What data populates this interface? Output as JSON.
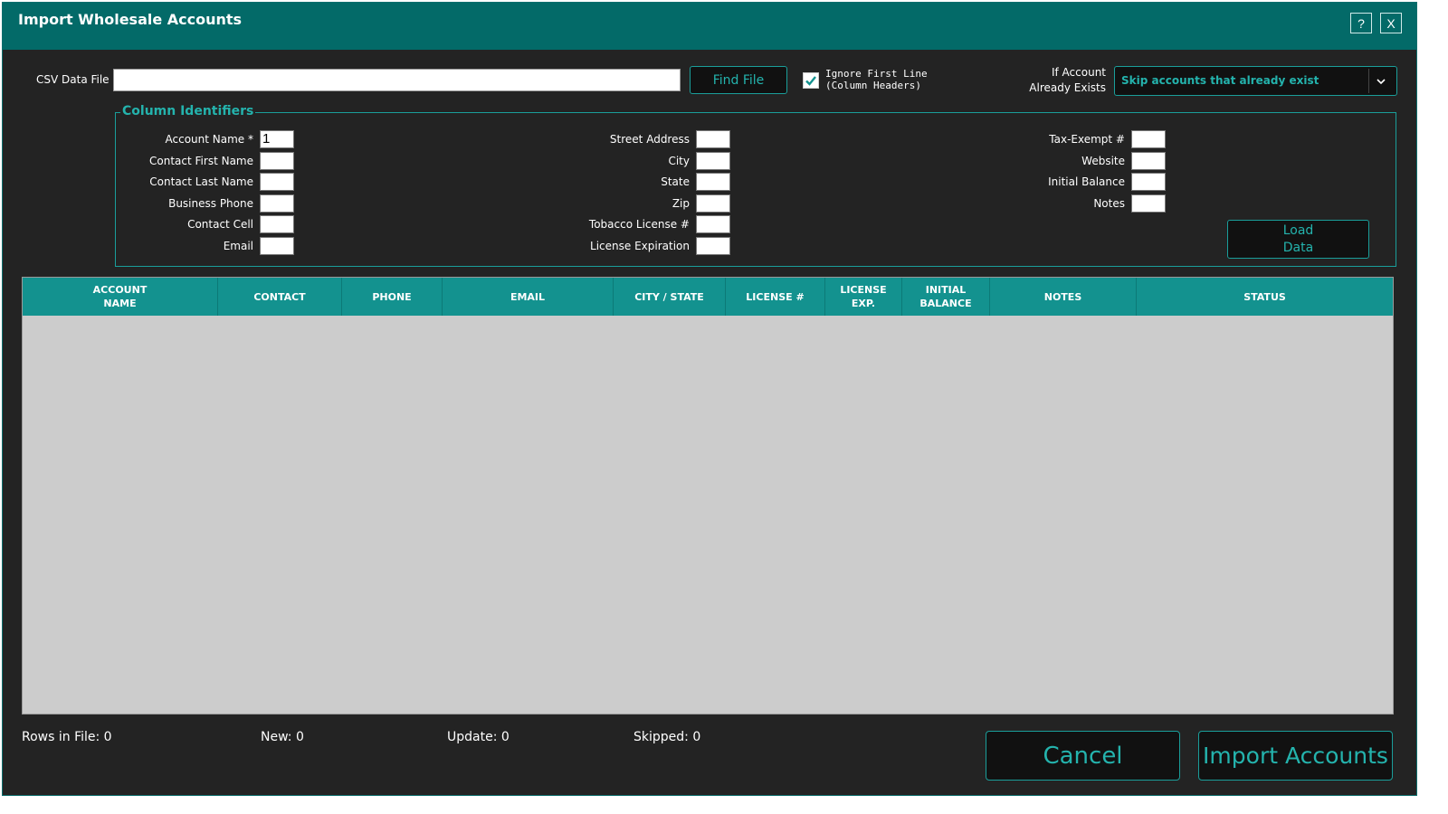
{
  "window": {
    "title": "Import Wholesale Accounts",
    "help_label": "?",
    "close_label": "X"
  },
  "file": {
    "label": "CSV Data File",
    "value": "",
    "find_button": "Find File",
    "ignore_first_line": true,
    "ignore_label_line1": "Ignore First Line",
    "ignore_label_line2": "(Column Headers)"
  },
  "exists": {
    "label_line1": "If Account",
    "label_line2": "Already Exists",
    "selected": "Skip accounts that already exist"
  },
  "columns_group": {
    "title": "Column Identifiers",
    "col1": [
      {
        "label": "Account Name *",
        "value": "1"
      },
      {
        "label": "Contact First Name",
        "value": ""
      },
      {
        "label": "Contact Last Name",
        "value": ""
      },
      {
        "label": "Business Phone",
        "value": ""
      },
      {
        "label": "Contact Cell",
        "value": ""
      },
      {
        "label": "Email",
        "value": ""
      }
    ],
    "col2": [
      {
        "label": "Street Address",
        "value": ""
      },
      {
        "label": "City",
        "value": ""
      },
      {
        "label": "State",
        "value": ""
      },
      {
        "label": "Zip",
        "value": ""
      },
      {
        "label": "Tobacco License #",
        "value": ""
      },
      {
        "label": "License Expiration",
        "value": ""
      }
    ],
    "col3": [
      {
        "label": "Tax-Exempt #",
        "value": ""
      },
      {
        "label": "Website",
        "value": ""
      },
      {
        "label": "Initial Balance",
        "value": ""
      },
      {
        "label": "Notes",
        "value": ""
      }
    ],
    "load_line1": "Load",
    "load_line2": "Data"
  },
  "grid": {
    "headers": [
      {
        "line1": "ACCOUNT",
        "line2": "NAME"
      },
      {
        "line1": "CONTACT",
        "line2": ""
      },
      {
        "line1": "PHONE",
        "line2": ""
      },
      {
        "line1": "EMAIL",
        "line2": ""
      },
      {
        "line1": "CITY / STATE",
        "line2": ""
      },
      {
        "line1": "LICENSE #",
        "line2": ""
      },
      {
        "line1": "LICENSE",
        "line2": "EXP."
      },
      {
        "line1": "INITIAL",
        "line2": "BALANCE"
      },
      {
        "line1": "NOTES",
        "line2": ""
      },
      {
        "line1": "STATUS",
        "line2": ""
      }
    ],
    "rows": []
  },
  "summary": {
    "rows_in_file": "Rows in File: 0",
    "new": "New: 0",
    "update": "Update: 0",
    "skipped": "Skipped: 0"
  },
  "actions": {
    "cancel": "Cancel",
    "import": "Import Accounts"
  },
  "colors": {
    "titlebar": "#036a68",
    "accent": "#1a9e9a",
    "accent_text": "#24b3ad",
    "grid_header": "#13928f",
    "grid_body": "#cccccc",
    "background": "#232323"
  }
}
